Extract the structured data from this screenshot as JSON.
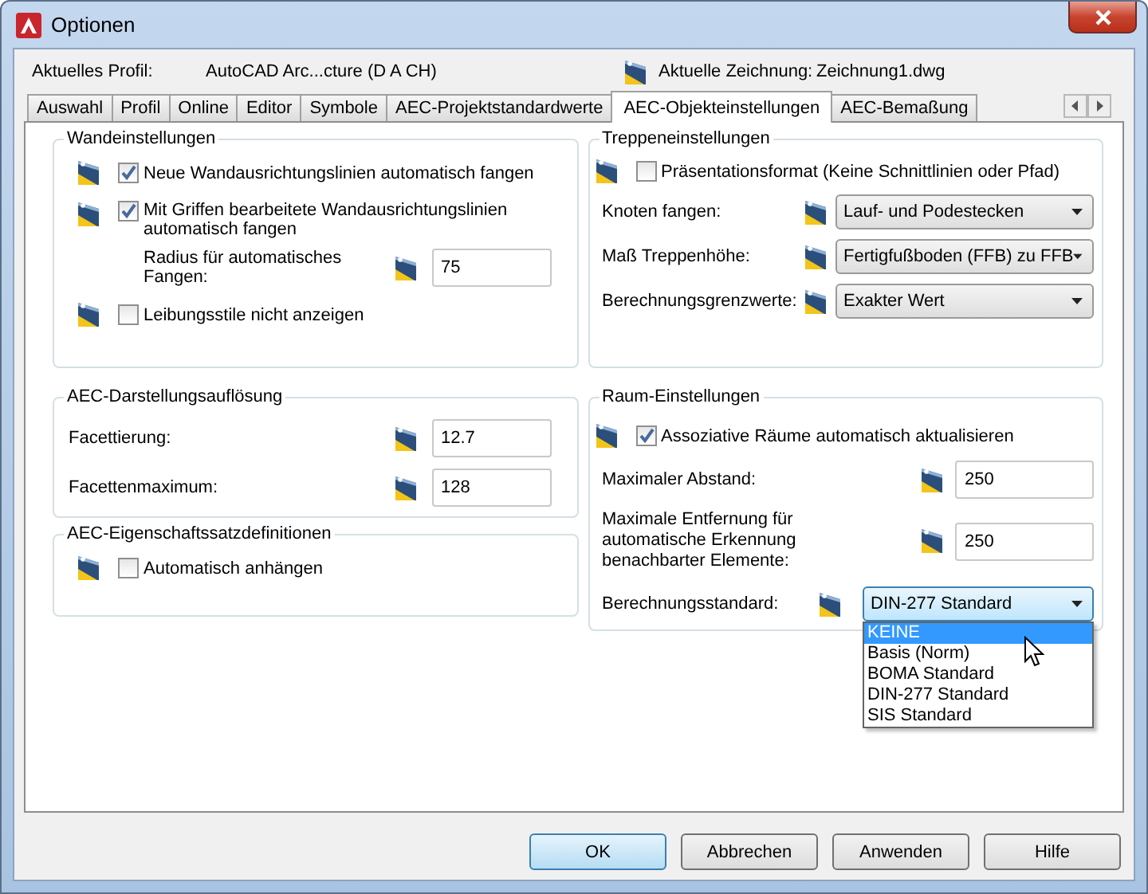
{
  "window": {
    "title": "Optionen"
  },
  "profile": {
    "label": "Aktuelles Profil:",
    "value": "AutoCAD Arc...cture (D A CH)"
  },
  "drawing": {
    "label": "Aktuelle Zeichnung:",
    "value": "Zeichnung1.dwg"
  },
  "tabs": [
    {
      "label": "Auswahl",
      "selected": false
    },
    {
      "label": "Profil",
      "selected": false
    },
    {
      "label": "Online",
      "selected": false
    },
    {
      "label": "Editor",
      "selected": false
    },
    {
      "label": "Symbole",
      "selected": false
    },
    {
      "label": "AEC-Projektstandardwerte",
      "selected": false
    },
    {
      "label": "AEC-Objekteinstellungen",
      "selected": true
    },
    {
      "label": "AEC-Bemaßung",
      "selected": false
    }
  ],
  "columns": [
    {
      "groups": [
        {
          "title": "Wandeinstellungen",
          "rows": [
            {
              "kind": "checkbox",
              "label": "Neue Wandausrichtungslinien automatisch fangen",
              "checked": true
            },
            {
              "kind": "checkbox",
              "label": "Mit Griffen bearbeitete Wandausrichtungslinien automatisch fangen",
              "checked": true
            },
            {
              "kind": "field",
              "label": "Radius für automatisches Fangen:",
              "value": "75"
            },
            {
              "kind": "checkbox",
              "label": "Leibungsstile nicht anzeigen",
              "checked": false
            }
          ]
        },
        {
          "title": "AEC-Darstellungsauflösung",
          "rows": [
            {
              "kind": "field",
              "label": "Facettierung:",
              "value": "12.7"
            },
            {
              "kind": "field",
              "label": "Facettenmaximum:",
              "value": "128"
            }
          ]
        },
        {
          "title": "AEC-Eigenschaftssatzdefinitionen",
          "rows": [
            {
              "kind": "checkbox",
              "label": "Automatisch anhängen",
              "checked": false
            }
          ]
        }
      ]
    },
    {
      "groups": [
        {
          "title": "Treppeneinstellungen",
          "rows": [
            {
              "kind": "checkbox",
              "label": "Präsentationsformat (Keine Schnittlinien oder Pfad)",
              "checked": false
            },
            {
              "kind": "combo",
              "label": "Knoten fangen:",
              "value": "Lauf- und Podestecken",
              "expanded": false
            },
            {
              "kind": "combo",
              "label": "Maß Treppenhöhe:",
              "value": "Fertigfußboden (FFB) zu FFB",
              "expanded": false
            },
            {
              "kind": "combo",
              "label": "Berechnungsgrenzwerte:",
              "value": "Exakter Wert",
              "expanded": false
            }
          ]
        },
        {
          "title": "Raum-Einstellungen",
          "rows": [
            {
              "kind": "checkbox",
              "label": "Assoziative Räume automatisch aktualisieren",
              "checked": true
            },
            {
              "kind": "field",
              "label": "Maximaler Abstand:",
              "value": "250"
            },
            {
              "kind": "field",
              "label": "Maximale Entfernung für automatische Erkennung benachbarter Elemente:",
              "value": "250"
            },
            {
              "kind": "combo",
              "label": "Berechnungsstandard:",
              "value": "DIN-277 Standard",
              "expanded": true,
              "options": [
                {
                  "label": "KEINE",
                  "highlighted": true
                },
                {
                  "label": "Basis (Norm)",
                  "highlighted": false
                },
                {
                  "label": "BOMA Standard",
                  "highlighted": false
                },
                {
                  "label": "DIN-277 Standard",
                  "highlighted": false
                },
                {
                  "label": "SIS Standard",
                  "highlighted": false
                }
              ]
            }
          ]
        }
      ]
    }
  ],
  "buttons": [
    {
      "label": "OK",
      "default": true
    },
    {
      "label": "Abbrechen",
      "default": false
    },
    {
      "label": "Anwenden",
      "default": false
    },
    {
      "label": "Hilfe",
      "default": false
    }
  ]
}
